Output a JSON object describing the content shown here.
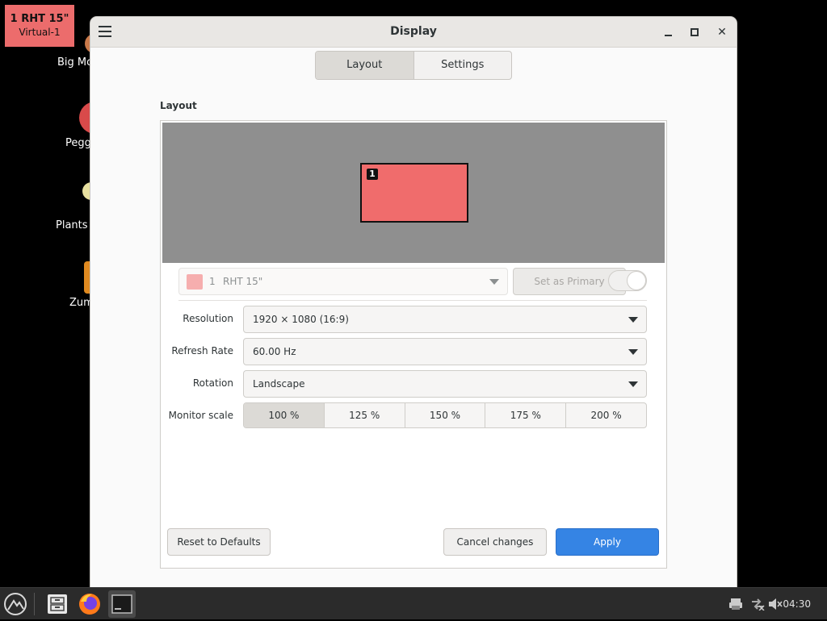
{
  "osd": {
    "line1": "1  RHT 15\"",
    "line2": "Virtual-1"
  },
  "desktop": {
    "icons": [
      {
        "label": "Big Mo",
        "color": "#c9794a"
      },
      {
        "label": "Pegg",
        "color": "#d94a4a"
      },
      {
        "label": "Plants v",
        "color": "#e8e0a0"
      },
      {
        "label": "Zum",
        "color": "#e08a20"
      }
    ]
  },
  "window": {
    "title": "Display",
    "tabs": [
      {
        "label": "Layout",
        "active": true
      },
      {
        "label": "Settings",
        "active": false
      }
    ],
    "section_label": "Layout",
    "monitor_number": "1",
    "monitor_select": {
      "number": "1",
      "name": "RHT 15\""
    },
    "set_primary_label": "Set as Primary",
    "toggle_on": false,
    "resolution": {
      "label": "Resolution",
      "value": "1920 × 1080 (16:9)"
    },
    "refresh": {
      "label": "Refresh Rate",
      "value": "60.00 Hz"
    },
    "rotation": {
      "label": "Rotation",
      "value": "Landscape"
    },
    "scale": {
      "label": "Monitor scale",
      "options": [
        "100 %",
        "125 %",
        "150 %",
        "175 %",
        "200 %"
      ],
      "selected": "100 %"
    },
    "buttons": {
      "reset": "Reset to Defaults",
      "cancel": "Cancel changes",
      "apply": "Apply"
    }
  },
  "taskbar": {
    "clock": "04:30"
  },
  "colors": {
    "accent": "#3584e4",
    "monitor": "#f06c6c",
    "arrangement_bg": "#8f8f8f"
  }
}
